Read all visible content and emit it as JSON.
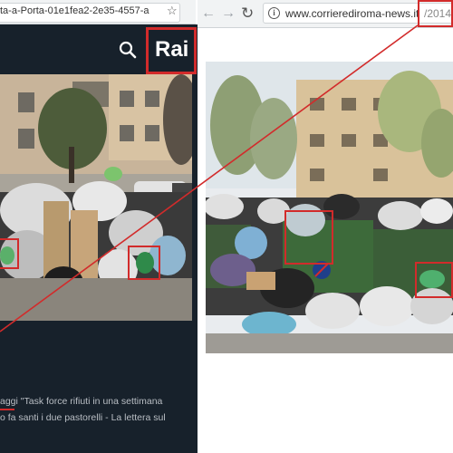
{
  "left_browser": {
    "url_fragment": "ta-a-Porta-01e1fea2-2e35-4557-a",
    "star_icon": "bookmark-star-icon"
  },
  "rai": {
    "logo": "Rai",
    "search_icon": "search-icon",
    "caption_line1": "aggi \"Task force rifiuti in una settimana",
    "caption_line2": "o fa santi i due pastorelli - La lettera sul",
    "colors": {
      "panel": "#17212b",
      "highlight": "#d22b2b"
    }
  },
  "right_browser": {
    "back_icon": "back-arrow-icon",
    "forward_icon": "forward-arrow-icon",
    "reload_icon": "reload-icon",
    "info_icon": "info-icon",
    "url_domain": "www.corrierediroma-news.it",
    "url_path": "/2014/"
  },
  "glyphs": {
    "star": "☆",
    "back": "←",
    "forward": "→",
    "reload": "↻",
    "info": "i"
  }
}
